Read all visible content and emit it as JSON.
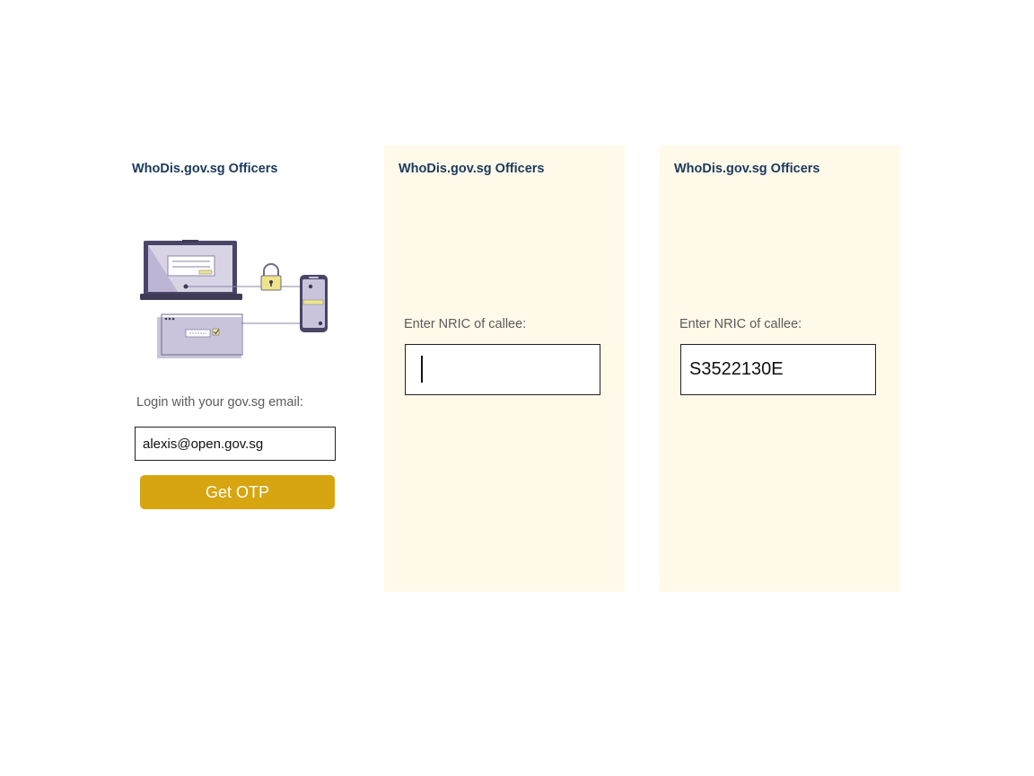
{
  "screens": [
    {
      "app_title": "WhoDis.gov.sg Officers",
      "login_prompt": "Login with your gov.sg email:",
      "email_value": "alexis@open.gov.sg",
      "otp_button_label": "Get OTP"
    },
    {
      "app_title": "WhoDis.gov.sg Officers",
      "nric_label": "Enter NRIC of callee:",
      "nric_value": ""
    },
    {
      "app_title": "WhoDis.gov.sg Officers",
      "nric_label": "Enter NRIC of callee:",
      "nric_value": "S3522130E"
    }
  ],
  "colors": {
    "title": "#1a3a5c",
    "panel_background": "#fff9e9",
    "button_background": "#d6a510",
    "button_text": "#ffffff",
    "label": "#5b5b5b"
  },
  "illustration": {
    "icons": [
      "laptop-icon",
      "padlock-icon",
      "smartphone-icon",
      "browser-window-icon"
    ]
  }
}
